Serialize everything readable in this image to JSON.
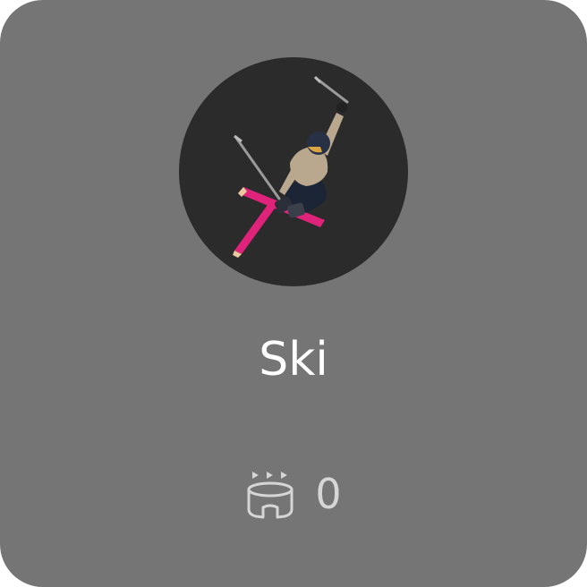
{
  "sport": {
    "name": "Ski",
    "image_subject": "freestyle-skier-jump",
    "count": "0",
    "count_icon": "stadium-icon"
  },
  "colors": {
    "card_background": "#757575",
    "avatar_background": "#2b2b2b",
    "title_text": "#ffffff",
    "count_text": "#d6d6d6",
    "ski_accent": "#e0237a"
  }
}
